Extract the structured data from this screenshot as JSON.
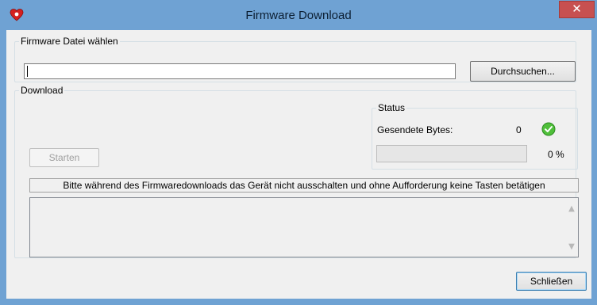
{
  "window": {
    "title": "Firmware Download",
    "close_glyph": "✕",
    "icon": "app-heart-icon",
    "titlebar_color": "#6fa2d3",
    "close_color": "#c75050"
  },
  "file_group": {
    "legend": "Firmware Datei wählen",
    "path_value": "",
    "browse_label": "Durchsuchen..."
  },
  "download_group": {
    "legend": "Download",
    "start_label": "Starten",
    "status": {
      "legend": "Status",
      "bytes_label": "Gesendete Bytes:",
      "bytes_value": "0",
      "status_icon": "check-circle-icon",
      "progress": 0,
      "percent_text": "0 %"
    },
    "warning_text": "Bitte während des Firmwaredownloads das Gerät nicht ausschalten und ohne Aufforderung keine Tasten betätigen",
    "log_text": ""
  },
  "footer": {
    "close_label": "Schließen"
  }
}
